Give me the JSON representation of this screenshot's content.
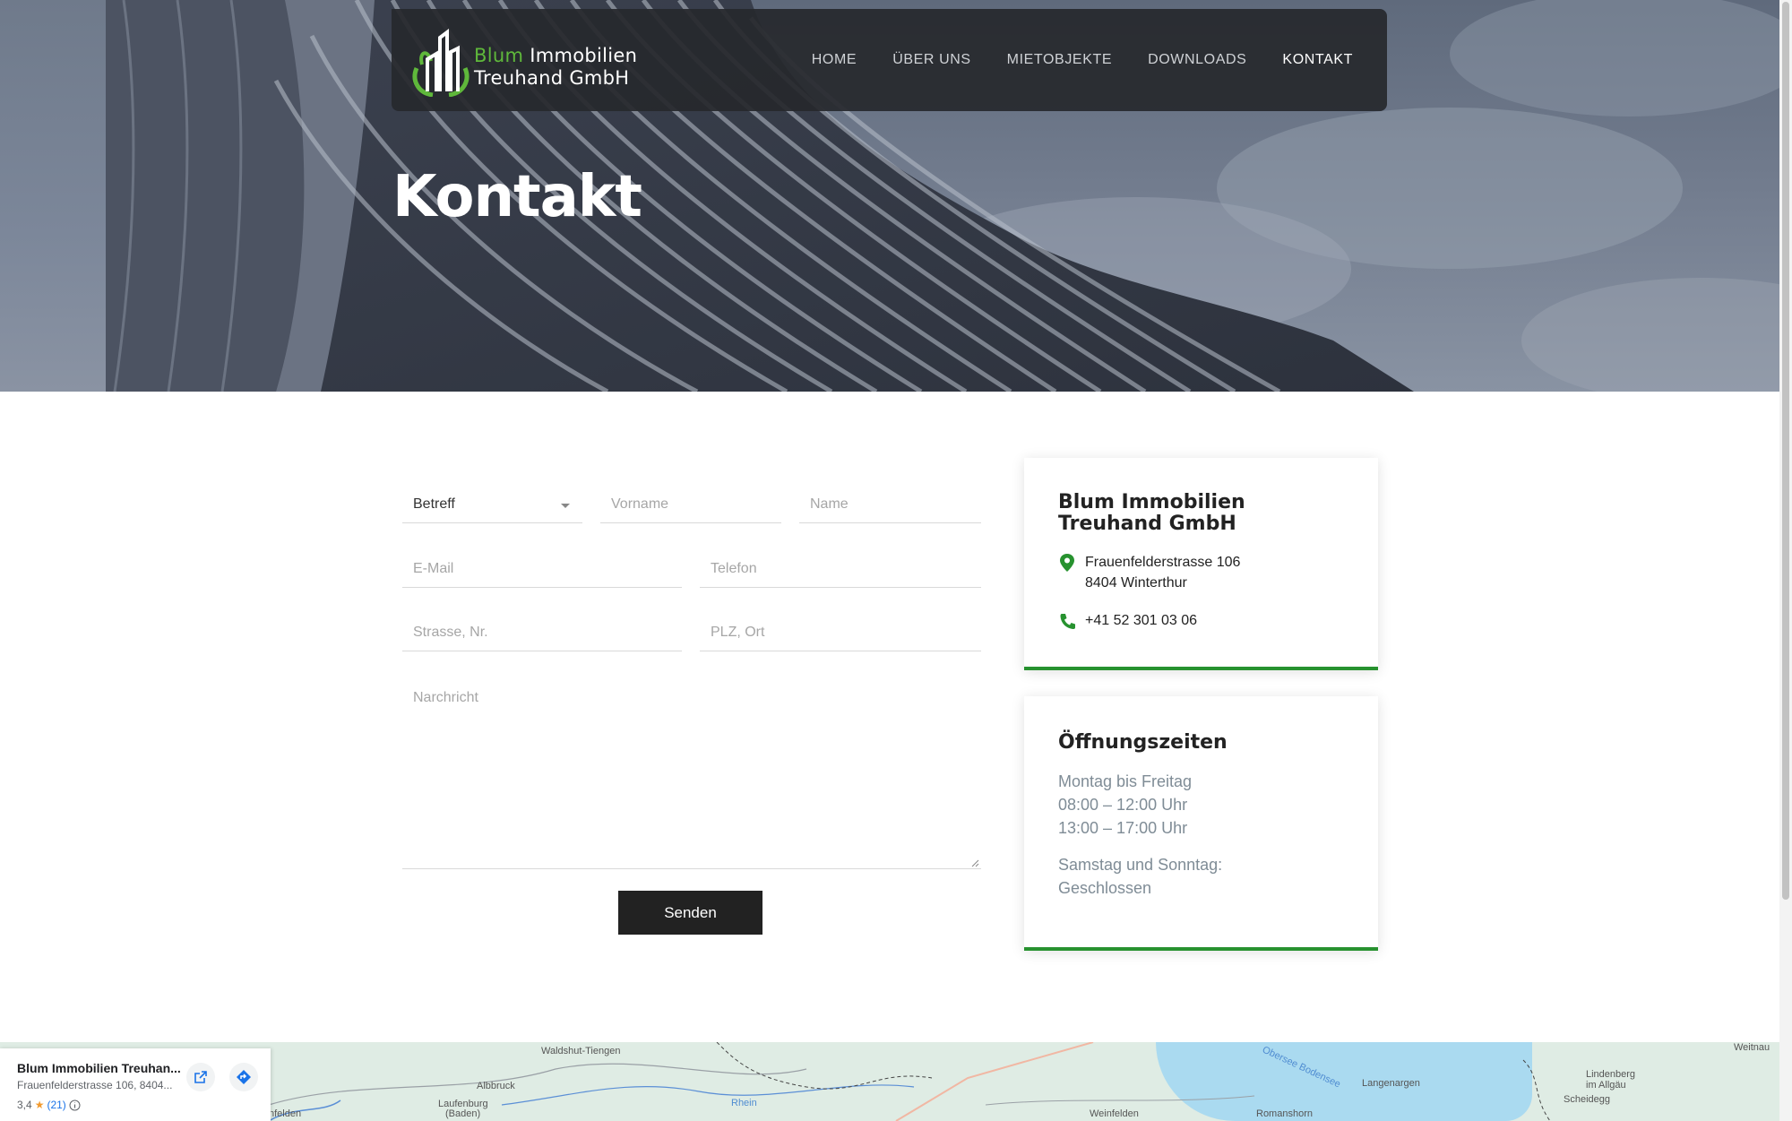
{
  "brand": {
    "logo_line1_word1": "Blum",
    "logo_line1_word2": "Immobilien",
    "logo_line2": "Treuhand GmbH"
  },
  "nav": {
    "items": [
      {
        "label": "HOME"
      },
      {
        "label": "ÜBER UNS"
      },
      {
        "label": "MIETOBJEKTE"
      },
      {
        "label": "DOWNLOADS"
      },
      {
        "label": "KONTAKT"
      }
    ],
    "active": "KONTAKT"
  },
  "hero": {
    "title": "Kontakt"
  },
  "form": {
    "betreff": "Betreff",
    "vorname_placeholder": "Vorname",
    "name_placeholder": "Name",
    "email_placeholder": "E-Mail",
    "telefon_placeholder": "Telefon",
    "strasse_placeholder": "Strasse, Nr.",
    "plz_placeholder": "PLZ, Ort",
    "nachricht_placeholder": "Narchricht",
    "submit_label": "Senden"
  },
  "contact_card": {
    "title_line1": "Blum Immobilien",
    "title_line2": "Treuhand GmbH",
    "address_line1": "Frauenfelderstrasse 106",
    "address_line2": "8404 Winterthur",
    "phone": "+41 52 301 03 06"
  },
  "hours_card": {
    "title": "Öffnungszeiten",
    "weekday_label": "Montag bis Freitag",
    "weekday_morning": "08:00 – 12:00 Uhr",
    "weekday_afternoon": "13:00 – 17:00 Uhr",
    "weekend_label": "Samstag und Sonntag:",
    "weekend_value": "Geschlossen"
  },
  "map": {
    "place_name": "Blum Immobilien Treuhan...",
    "place_address": "Frauenfelderstrasse 106, 8404...",
    "rating": "3,4",
    "review_count": "(21)",
    "labels": [
      {
        "text": "Waldshut-Tiengen"
      },
      {
        "text": "Albbruck"
      },
      {
        "text": "Laufenburg"
      },
      {
        "text": "(Baden)"
      },
      {
        "text": "Rhein"
      },
      {
        "text": "Weinfelden"
      },
      {
        "text": "Romanshorn"
      },
      {
        "text": "Langenargen"
      },
      {
        "text": "Lindenberg"
      },
      {
        "text": "im Allgäu"
      },
      {
        "text": "Scheidegg"
      },
      {
        "text": "Obersee Bodensee"
      },
      {
        "text": "nfelden"
      },
      {
        "text": "Weitnau"
      }
    ],
    "colors": {
      "land": "#dfece4",
      "water": "#aadaf0"
    }
  },
  "colors": {
    "accent": "#27922f",
    "nav_bg": "#26282c",
    "button_bg": "#222222"
  }
}
